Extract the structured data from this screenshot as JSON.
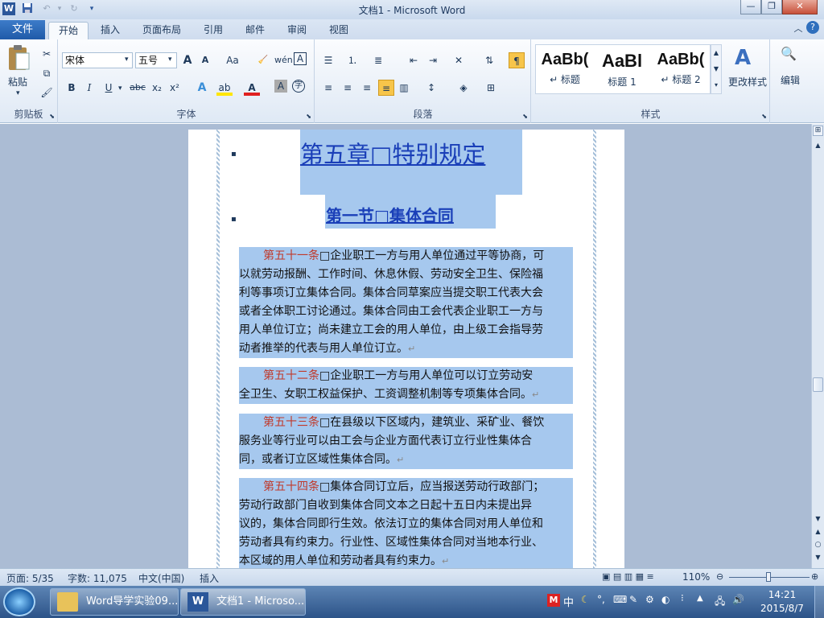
{
  "titlebar": {
    "title": "文档1  -  Microsoft Word",
    "app_icon": "W",
    "minimize": "—",
    "maximize": "❐",
    "close": "✕"
  },
  "tabs": [
    {
      "label": "文件"
    },
    {
      "label": "开始"
    },
    {
      "label": "插入"
    },
    {
      "label": "页面布局"
    },
    {
      "label": "引用"
    },
    {
      "label": "邮件"
    },
    {
      "label": "审阅"
    },
    {
      "label": "视图"
    }
  ],
  "ribbon": {
    "clipboard": {
      "paste_label": "粘贴",
      "group_label": "剪贴板"
    },
    "font": {
      "font_name": "宋体",
      "font_size": "五号",
      "group_label": "字体",
      "grow": "A",
      "shrink": "A",
      "case": "Aa",
      "bold": "B",
      "italic": "I",
      "underline": "U",
      "strike": "abc",
      "subscript": "x₂",
      "superscript": "x²",
      "clear": "A",
      "char_border": "A"
    },
    "paragraph": {
      "group_label": "段落"
    },
    "styles": {
      "group_label": "样式",
      "items": [
        {
          "preview": "AaBb(",
          "label": "↵ 标题"
        },
        {
          "preview": "AaBl",
          "label": "标题 1"
        },
        {
          "preview": "AaBb(",
          "label": "↵ 标题 2"
        }
      ],
      "change_styles": "更改样式"
    },
    "editing": {
      "label": "编辑"
    }
  },
  "document": {
    "chapter_title": "第五章□特别规定",
    "section_title": "第一节□集体合同",
    "articles": [
      {
        "num": "第五十一条",
        "lines": [
          "□企业职工一方与用人单位通过平等协商，可",
          "以就劳动报酬、工作时间、休息休假、劳动安全卫生、保险福",
          "利等事项订立集体合同。集体合同草案应当提交职工代表大会",
          "或者全体职工讨论通过。集体合同由工会代表企业职工一方与",
          "用人单位订立；尚未建立工会的用人单位，由上级工会指导劳",
          "动者推举的代表与用人单位订立。"
        ]
      },
      {
        "num": "第五十二条",
        "lines": [
          "□企业职工一方与用人单位可以订立劳动安",
          "全卫生、女职工权益保护、工资调整机制等专项集体合同。"
        ]
      },
      {
        "num": "第五十三条",
        "lines": [
          "□在县级以下区域内，建筑业、采矿业、餐饮",
          "服务业等行业可以由工会与企业方面代表订立行业性集体合",
          "同，或者订立区域性集体合同。"
        ]
      },
      {
        "num": "第五十四条",
        "lines": [
          "□集体合同订立后，应当报送劳动行政部门；",
          "劳动行政部门自收到集体合同文本之日起十五日内未提出异",
          "议的，集体合同即行生效。依法订立的集体合同对用人单位和",
          "劳动者具有约束力。行业性、区域性集体合同对当地本行业、",
          "本区域的用人单位和劳动者具有约束力。"
        ]
      }
    ],
    "para_mark": "↵"
  },
  "status": {
    "page": "页面: 5/35",
    "words": "字数: 11,075",
    "lang": "中文(中国)",
    "mode": "插入",
    "zoom": "110%"
  },
  "taskbar": {
    "item1": "Word导学实验09...",
    "item2": "文档1 - Microso...",
    "ime": "中",
    "time": "14:21",
    "date": "2015/8/7"
  }
}
